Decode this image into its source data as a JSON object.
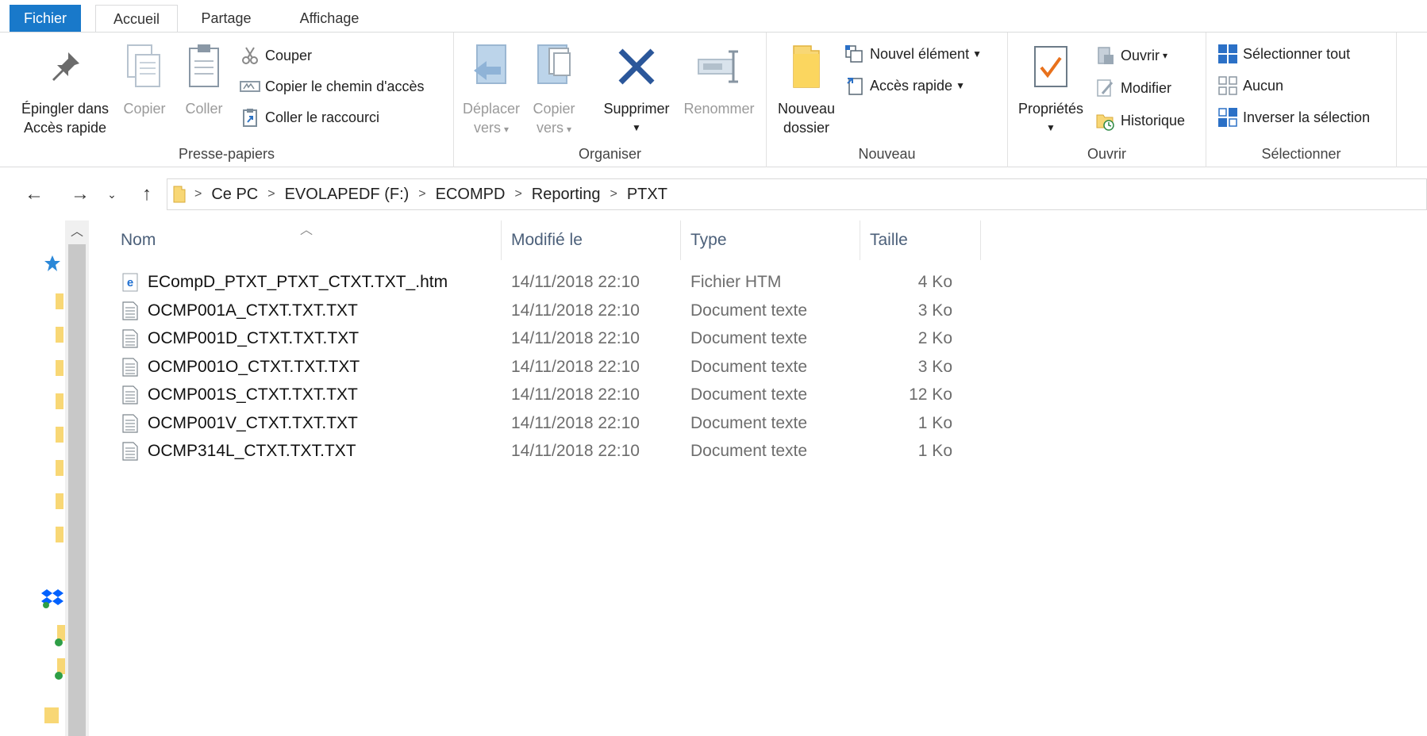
{
  "ribbon_tabs": {
    "file": "Fichier",
    "home": "Accueil",
    "share": "Partage",
    "view": "Affichage"
  },
  "clipboard": {
    "pin_line1": "Épingler dans",
    "pin_line2": "Accès rapide",
    "copy": "Copier",
    "paste": "Coller",
    "cut": "Couper",
    "copy_path": "Copier le chemin d'accès",
    "paste_shortcut": "Coller le raccourci",
    "label": "Presse-papiers"
  },
  "organize": {
    "move_line1": "Déplacer",
    "move_line2": "vers",
    "copy_line1": "Copier",
    "copy_line2": "vers",
    "delete": "Supprimer",
    "rename": "Renommer",
    "label": "Organiser"
  },
  "new": {
    "folder_line1": "Nouveau",
    "folder_line2": "dossier",
    "new_item": "Nouvel élément",
    "quick_access": "Accès rapide",
    "label": "Nouveau"
  },
  "open": {
    "properties": "Propriétés",
    "open": "Ouvrir",
    "edit": "Modifier",
    "history": "Historique",
    "label": "Ouvrir"
  },
  "select": {
    "select_all": "Sélectionner tout",
    "select_none": "Aucun",
    "invert": "Inverser la sélection",
    "label": "Sélectionner"
  },
  "address": {
    "crumbs": [
      "Ce PC",
      "EVOLAPEDF (F:)",
      "ECOMPD",
      "Reporting",
      "PTXT"
    ]
  },
  "columns": {
    "name": "Nom",
    "modified": "Modifié le",
    "type": "Type",
    "size": "Taille"
  },
  "files": [
    {
      "name": "ECompD_PTXT_PTXT_CTXT.TXT_.htm",
      "modified": "14/11/2018 22:10",
      "type": "Fichier HTM",
      "size": "4 Ko",
      "icon": "html-file-icon"
    },
    {
      "name": "OCMP001A_CTXT.TXT.TXT",
      "modified": "14/11/2018 22:10",
      "type": "Document texte",
      "size": "3 Ko",
      "icon": "text-file-icon"
    },
    {
      "name": "OCMP001D_CTXT.TXT.TXT",
      "modified": "14/11/2018 22:10",
      "type": "Document texte",
      "size": "2 Ko",
      "icon": "text-file-icon"
    },
    {
      "name": "OCMP001O_CTXT.TXT.TXT",
      "modified": "14/11/2018 22:10",
      "type": "Document texte",
      "size": "3 Ko",
      "icon": "text-file-icon"
    },
    {
      "name": "OCMP001S_CTXT.TXT.TXT",
      "modified": "14/11/2018 22:10",
      "type": "Document texte",
      "size": "12 Ko",
      "icon": "text-file-icon"
    },
    {
      "name": "OCMP001V_CTXT.TXT.TXT",
      "modified": "14/11/2018 22:10",
      "type": "Document texte",
      "size": "1 Ko",
      "icon": "text-file-icon"
    },
    {
      "name": "OCMP314L_CTXT.TXT.TXT",
      "modified": "14/11/2018 22:10",
      "type": "Document texte",
      "size": "1 Ko",
      "icon": "text-file-icon"
    }
  ],
  "colors": {
    "file_tab": "#1979ca",
    "column_header_text": "#4c607a",
    "folder_yellow": "#f8d775",
    "delete_blue": "#2b579a",
    "check_orange": "#e8711c"
  }
}
